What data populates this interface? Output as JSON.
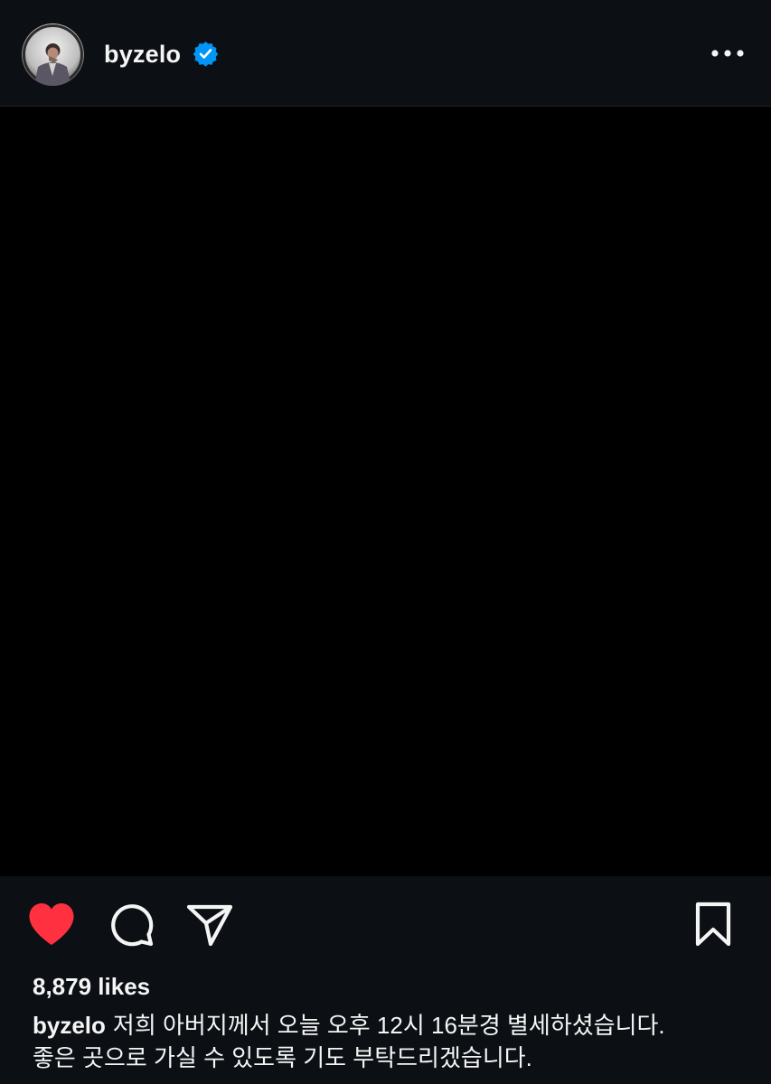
{
  "post": {
    "username": "byzelo",
    "verified": true,
    "avatar_icon": "avatar-photo",
    "more_icon": "more-horizontal-icon",
    "media_color": "#000000"
  },
  "actions": {
    "like_icon": "heart-filled-icon",
    "like_color": "#ff3040",
    "comment_icon": "comment-icon",
    "share_icon": "share-paper-plane-icon",
    "save_icon": "bookmark-icon"
  },
  "likes_text": "8,879 likes",
  "caption": {
    "username": "byzelo",
    "line1": "저희 아버지께서 오늘 오후 12시 16분경 별세하셨습니다.",
    "line2": "좋은 곳으로 가실 수 있도록 기도 부탁드리겠습니다."
  },
  "colors": {
    "background": "#0c1014",
    "verified_blue": "#0095f6",
    "text": "#f5f5f5"
  }
}
